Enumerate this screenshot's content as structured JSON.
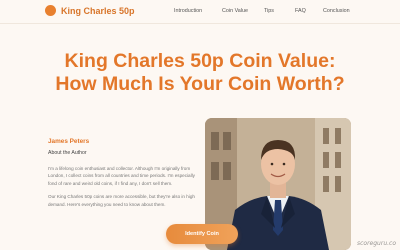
{
  "brand": {
    "name": "King Charles 50p",
    "accent": "#e3772a"
  },
  "nav": {
    "items": [
      {
        "label": "Introduction"
      },
      {
        "label": "Coin Value"
      },
      {
        "label": "Tips"
      },
      {
        "label": "FAQ"
      },
      {
        "label": "Conclusion"
      }
    ]
  },
  "hero": {
    "title_line1": "King Charles 50p Coin Value:",
    "title_line2": "How Much Is Your Coin Worth?"
  },
  "author": {
    "name": "James Peters",
    "subtitle": "About the Author",
    "bio": "I'm a lifelong coin enthusiast and collector. Although I'm originally from London, I collect coins from all countries and time periods. I'm especially fond of rare and weird old coins, if I find any, I don't sell them.",
    "bio2": "Our King Charles 50p coins are more accessible, but they're also in high demand. Here's everything you need to know about them."
  },
  "cta": {
    "label": "Identify Coin"
  },
  "watermark": "scoreguru.co"
}
